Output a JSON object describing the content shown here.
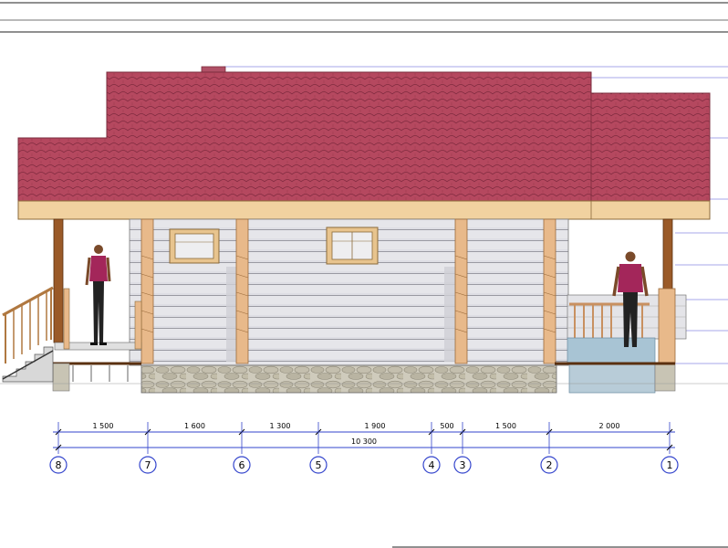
{
  "dimensions": {
    "segments": [
      "1 500",
      "1 600",
      "1 300",
      "1 900",
      "500",
      "1 500",
      "2 000"
    ],
    "total": "10 300"
  },
  "axes": [
    "8",
    "7",
    "6",
    "5",
    "4",
    "3",
    "2",
    "1"
  ],
  "colors": {
    "roof": "#b5485f",
    "fascia": "#f1d2a0",
    "wall": "#e4e4e8",
    "post": "#e8b98a",
    "stone": "#c8c4b4",
    "dim_line": "#3344cc",
    "figure_shirt": "#a3265a"
  }
}
